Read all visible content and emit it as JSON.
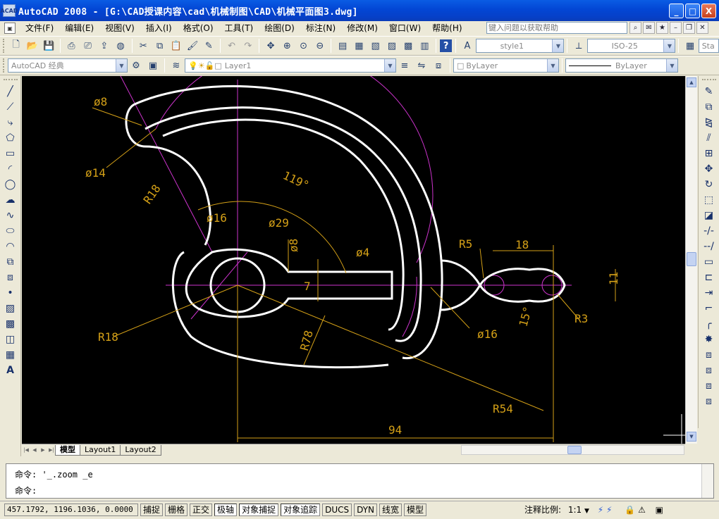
{
  "window": {
    "app_icon": "ACAD",
    "title": "AutoCAD 2008 - [G:\\CAD授课内容\\cad\\机械制图\\CAD\\机械平面图3.dwg]",
    "buttons": {
      "minimize": "_",
      "maximize": "□",
      "close": "X"
    }
  },
  "menubar": {
    "items": [
      "文件(F)",
      "编辑(E)",
      "视图(V)",
      "插入(I)",
      "格式(O)",
      "工具(T)",
      "绘图(D)",
      "标注(N)",
      "修改(M)",
      "窗口(W)",
      "帮助(H)"
    ],
    "help_placeholder": "键入问题以获取帮助"
  },
  "toolbars": {
    "text_style": "style1",
    "dim_style": "ISO-25",
    "dim_style_extra": "Sta",
    "workspace": "AutoCAD 经典",
    "layer": "Layer1",
    "color": "ByLayer",
    "linetype": "ByLayer"
  },
  "drawing": {
    "background": "#000000",
    "geometry_color": "#ffffff",
    "centerline_color": "#cc33cc",
    "dimension_color": "#d4a017",
    "dimensions": [
      {
        "id": "d8",
        "text": "ø8"
      },
      {
        "id": "d14",
        "text": "ø14"
      },
      {
        "id": "r18a",
        "text": "R18"
      },
      {
        "id": "ang119",
        "text": "119°"
      },
      {
        "id": "d16a",
        "text": "ø16"
      },
      {
        "id": "d29",
        "text": "ø29"
      },
      {
        "id": "d8b",
        "text": "ø8"
      },
      {
        "id": "d4",
        "text": "ø4"
      },
      {
        "id": "seven",
        "text": "7"
      },
      {
        "id": "r5",
        "text": "R5"
      },
      {
        "id": "eighteen",
        "text": "18"
      },
      {
        "id": "eleven",
        "text": "11"
      },
      {
        "id": "r3",
        "text": "R3"
      },
      {
        "id": "d16b",
        "text": "ø16"
      },
      {
        "id": "ang15",
        "text": "15°"
      },
      {
        "id": "r78",
        "text": "R78"
      },
      {
        "id": "r18b",
        "text": "R18"
      },
      {
        "id": "r54",
        "text": "R54"
      },
      {
        "id": "ninetyfour",
        "text": "94"
      }
    ]
  },
  "layout_tabs": [
    "模型",
    "Layout1",
    "Layout2"
  ],
  "command": {
    "line1": "命令: '_.zoom _e",
    "line2": "命令:"
  },
  "statusbar": {
    "coords": "457.1792, 1196.1036, 0.0000",
    "toggles": [
      "捕捉",
      "栅格",
      "正交",
      "极轴",
      "对象捕捉",
      "对象追踪",
      "DUCS",
      "DYN",
      "线宽",
      "模型"
    ],
    "annotation_scale_label": "注释比例:",
    "annotation_scale": "1:1"
  }
}
